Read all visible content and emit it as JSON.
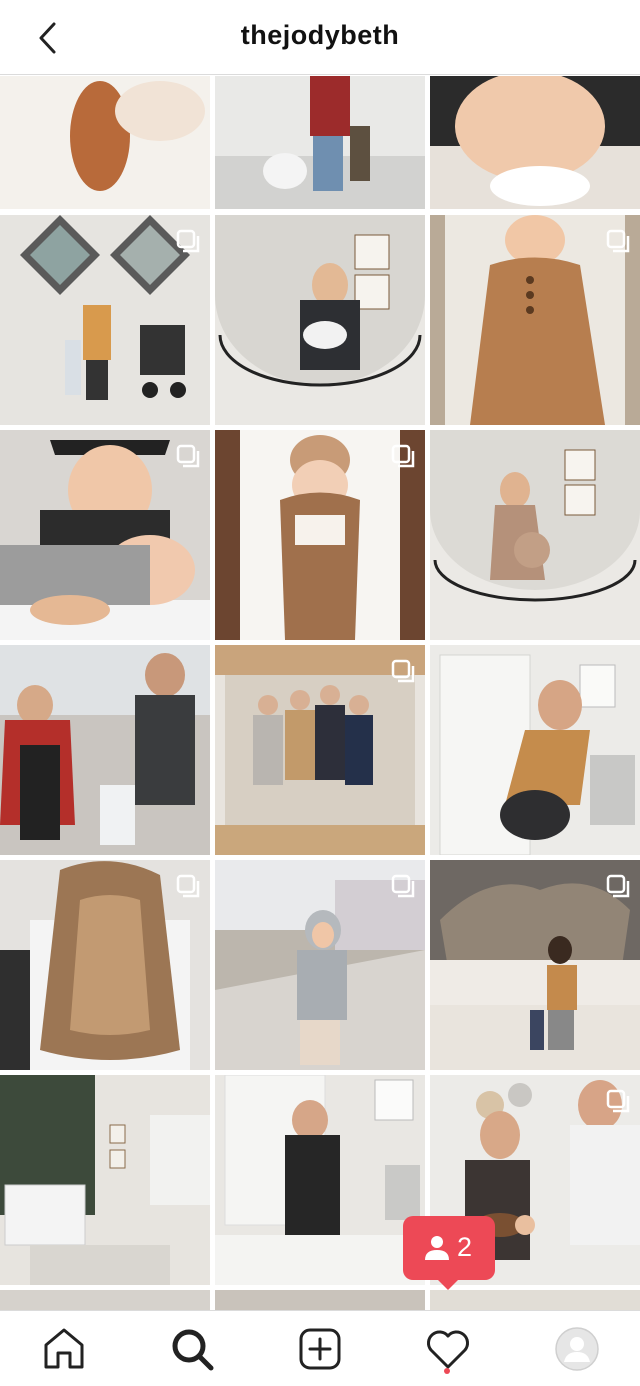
{
  "header": {
    "username": "thejodybeth"
  },
  "notification": {
    "count": "2"
  },
  "colors": {
    "notification": "#ed4956",
    "divider": "#dbdbdb"
  },
  "tabs": [
    "home-icon",
    "search-icon",
    "new-post-icon",
    "activity-icon",
    "profile-icon"
  ],
  "grid": {
    "posts": [
      {
        "id": "post-1",
        "multi": false
      },
      {
        "id": "post-2",
        "multi": false
      },
      {
        "id": "post-3",
        "multi": false
      },
      {
        "id": "post-4",
        "multi": true
      },
      {
        "id": "post-5",
        "multi": false
      },
      {
        "id": "post-6",
        "multi": true
      },
      {
        "id": "post-7",
        "multi": true
      },
      {
        "id": "post-8",
        "multi": true
      },
      {
        "id": "post-9",
        "multi": false
      },
      {
        "id": "post-10",
        "multi": false
      },
      {
        "id": "post-11",
        "multi": true
      },
      {
        "id": "post-12",
        "multi": false
      },
      {
        "id": "post-13",
        "multi": true
      },
      {
        "id": "post-14",
        "multi": true
      },
      {
        "id": "post-15",
        "multi": true
      },
      {
        "id": "post-16",
        "multi": false
      },
      {
        "id": "post-17",
        "multi": false
      },
      {
        "id": "post-18",
        "multi": true
      },
      {
        "id": "post-19",
        "multi": false
      },
      {
        "id": "post-20",
        "multi": false
      },
      {
        "id": "post-21",
        "multi": false
      }
    ]
  }
}
